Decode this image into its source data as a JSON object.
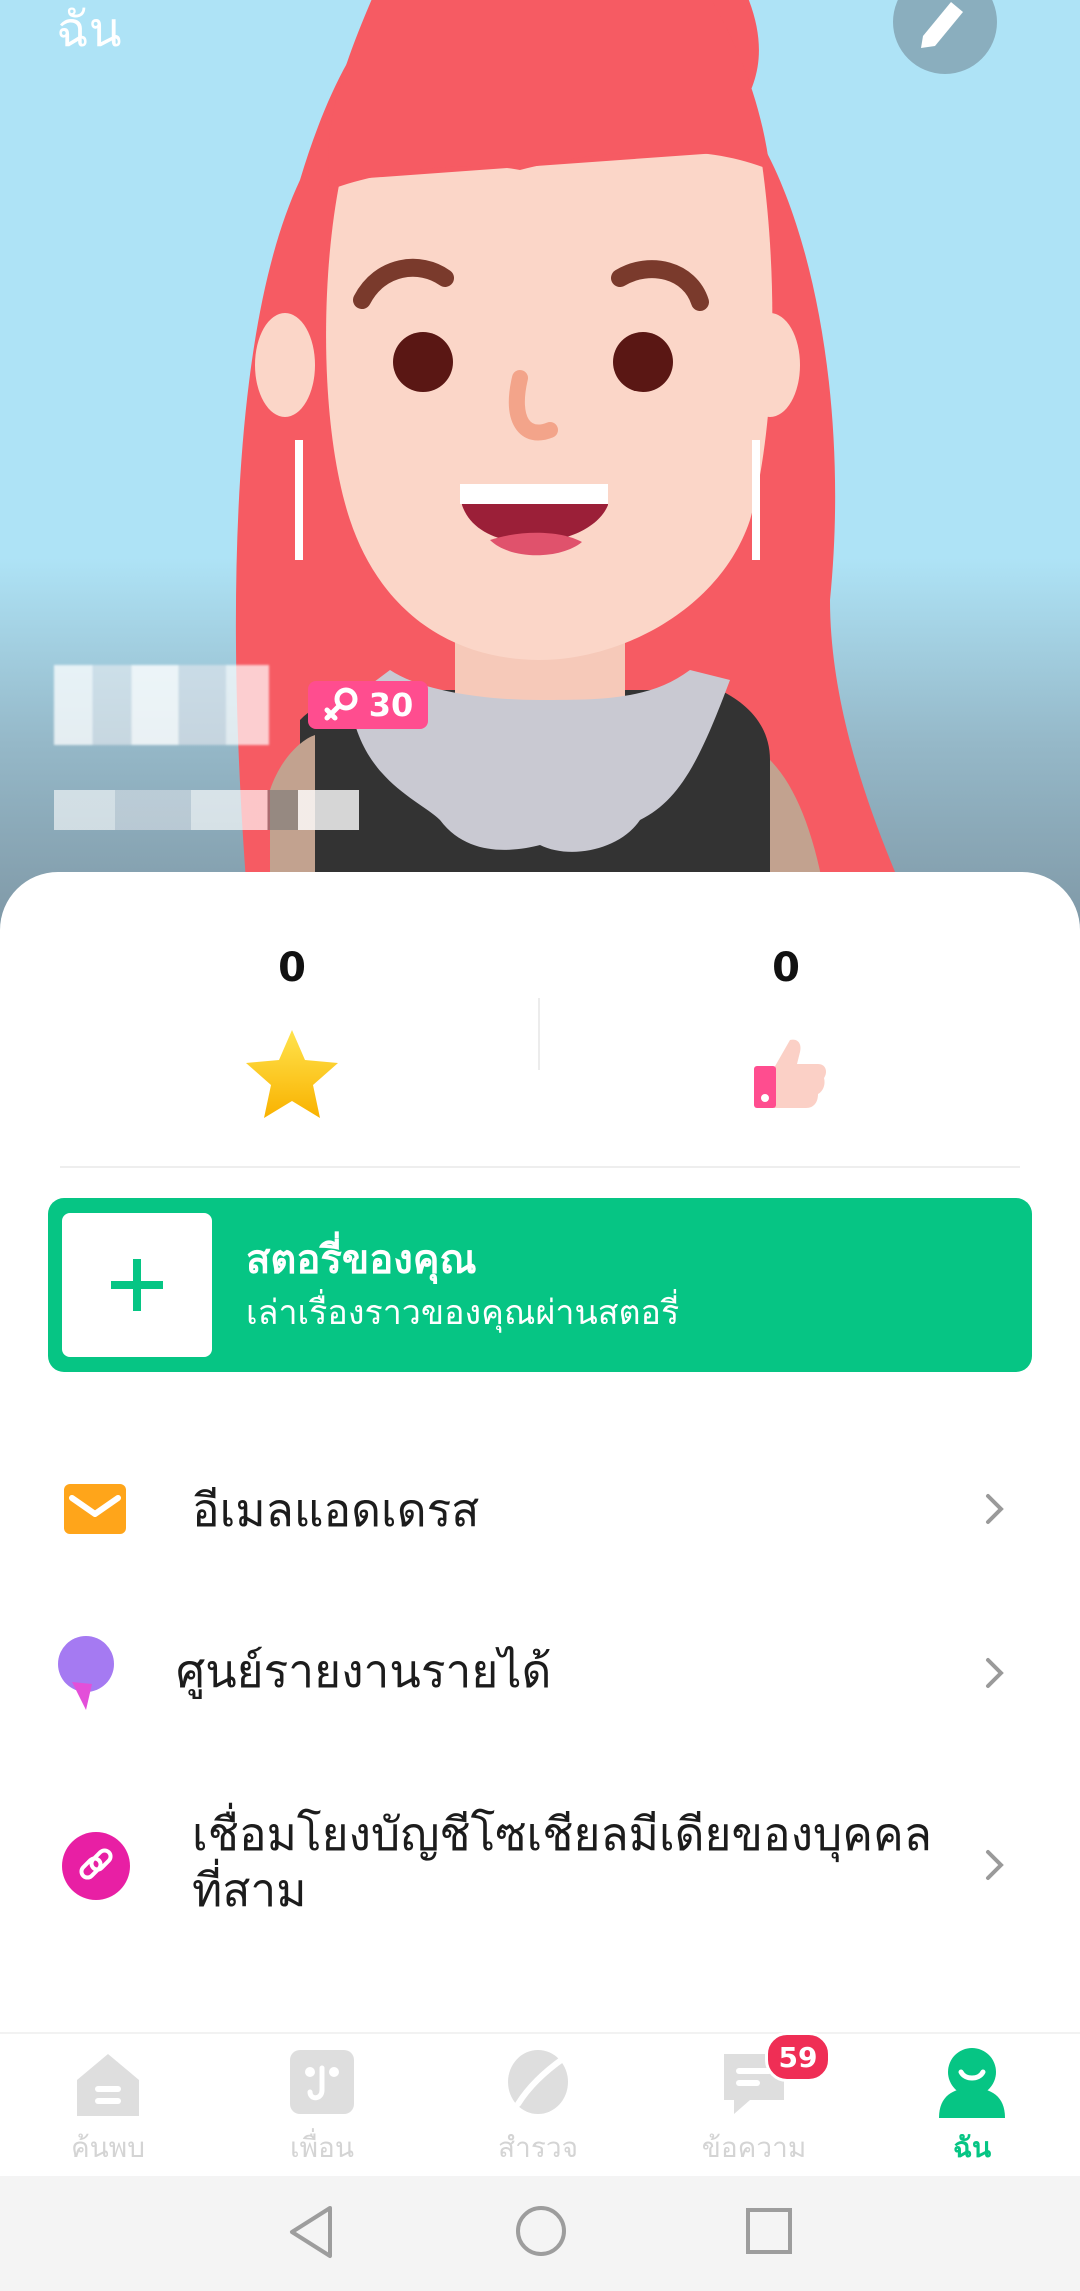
{
  "hero": {
    "title": "ฉัน",
    "level_badge": "30",
    "colors": {
      "sky": "#aee3f6",
      "hair": "#f65b63",
      "badge": "#ff4d8f"
    }
  },
  "stats": [
    {
      "value": "0",
      "icon": "star-icon"
    },
    {
      "value": "0",
      "icon": "thumbs-up-icon"
    }
  ],
  "story": {
    "title": "สตอรี่ของคุณ",
    "subtitle": "เล่าเรื่องราวของคุณผ่านสตอรี่",
    "color": "#06c584"
  },
  "menu": [
    {
      "label": "อีเมลแอดเดรส",
      "icon": "email-icon"
    },
    {
      "label": "ศูนย์รายงานรายได้",
      "icon": "microphone-icon"
    },
    {
      "label_line1": "เชื่อมโยงบัญชีโซเชียลมีเดียของบุคคล",
      "label_line2": "ที่สาม",
      "icon": "link-icon"
    }
  ],
  "nav": {
    "items": [
      {
        "label": "ค้นพบ",
        "icon": "home-icon"
      },
      {
        "label": "เพื่อน",
        "icon": "friends-icon"
      },
      {
        "label": "สำรวจ",
        "icon": "explore-icon"
      },
      {
        "label": "ข้อความ",
        "icon": "message-icon",
        "badge": "59"
      },
      {
        "label": "ฉัน",
        "icon": "profile-icon",
        "active": true
      }
    ]
  }
}
